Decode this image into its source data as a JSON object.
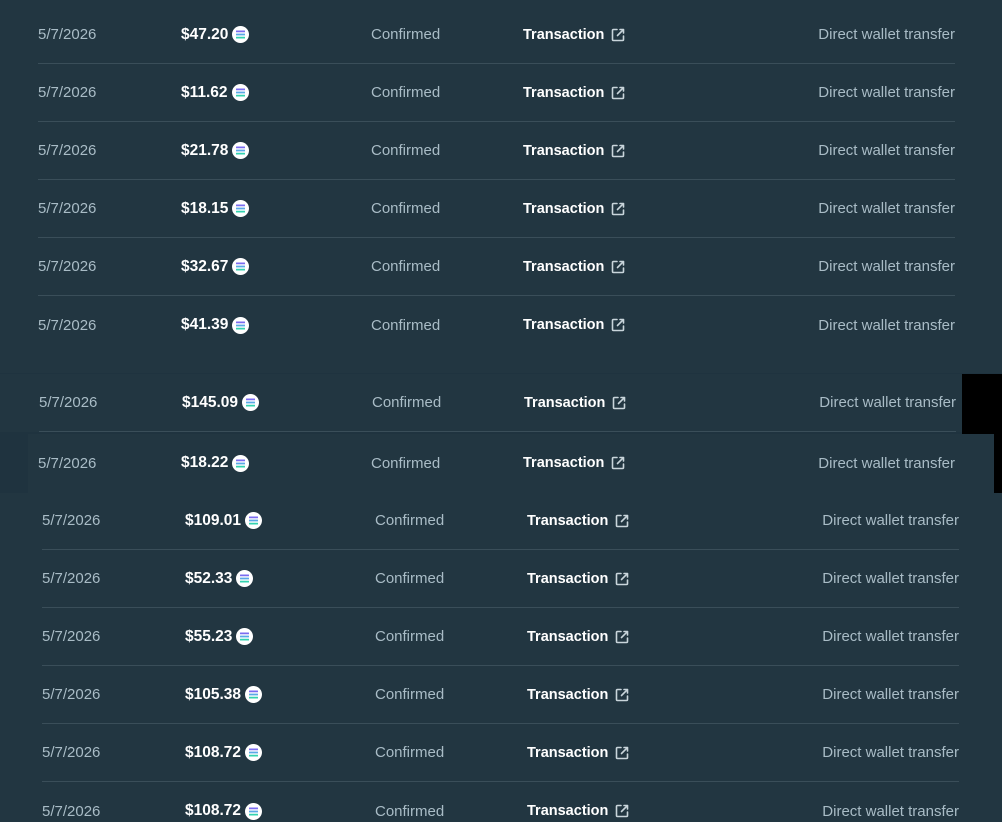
{
  "rows": [
    {
      "date": "5/7/2026",
      "amount": "$47.20",
      "status": "Confirmed",
      "link": "Transaction",
      "method": "Direct wallet transfer"
    },
    {
      "date": "5/7/2026",
      "amount": "$11.62",
      "status": "Confirmed",
      "link": "Transaction",
      "method": "Direct wallet transfer"
    },
    {
      "date": "5/7/2026",
      "amount": "$21.78",
      "status": "Confirmed",
      "link": "Transaction",
      "method": "Direct wallet transfer"
    },
    {
      "date": "5/7/2026",
      "amount": "$18.15",
      "status": "Confirmed",
      "link": "Transaction",
      "method": "Direct wallet transfer"
    },
    {
      "date": "5/7/2026",
      "amount": "$32.67",
      "status": "Confirmed",
      "link": "Transaction",
      "method": "Direct wallet transfer"
    },
    {
      "date": "5/7/2026",
      "amount": "$41.39",
      "status": "Confirmed",
      "link": "Transaction",
      "method": "Direct wallet transfer"
    },
    {
      "date": "5/7/2026",
      "amount": "$145.09",
      "status": "Confirmed",
      "link": "Transaction",
      "method": "Direct wallet transfer"
    },
    {
      "date": "5/7/2026",
      "amount": "$18.22",
      "status": "Confirmed",
      "link": "Transaction",
      "method": "Direct wallet transfer"
    },
    {
      "date": "5/7/2026",
      "amount": "$109.01",
      "status": "Confirmed",
      "link": "Transaction",
      "method": "Direct wallet transfer"
    },
    {
      "date": "5/7/2026",
      "amount": "$52.33",
      "status": "Confirmed",
      "link": "Transaction",
      "method": "Direct wallet transfer"
    },
    {
      "date": "5/7/2026",
      "amount": "$55.23",
      "status": "Confirmed",
      "link": "Transaction",
      "method": "Direct wallet transfer"
    },
    {
      "date": "5/7/2026",
      "amount": "$105.38",
      "status": "Confirmed",
      "link": "Transaction",
      "method": "Direct wallet transfer"
    },
    {
      "date": "5/7/2026",
      "amount": "$108.72",
      "status": "Confirmed",
      "link": "Transaction",
      "method": "Direct wallet transfer"
    },
    {
      "date": "5/7/2026",
      "amount": "$108.72",
      "status": "Confirmed",
      "link": "Transaction",
      "method": "Direct wallet transfer"
    }
  ],
  "icons": {
    "currency": "solana-coin-icon",
    "link": "external-link-icon"
  },
  "colors": {
    "background": "#223641",
    "text_muted": "#a9bcc6",
    "text_strong": "#ffffff",
    "divider": "#3a4e59"
  }
}
